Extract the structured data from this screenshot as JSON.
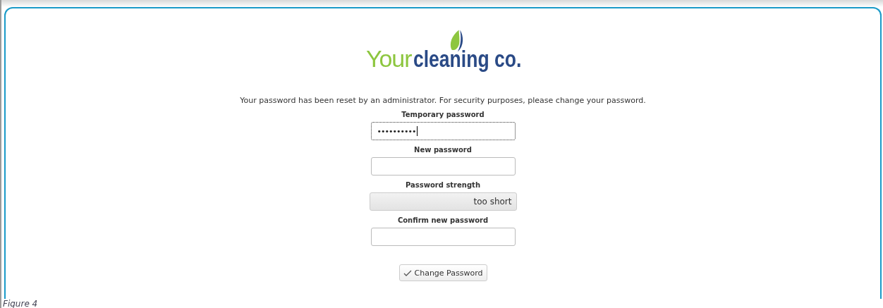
{
  "logo": {
    "word_1": "Your",
    "word_2": "cleaning co."
  },
  "message": "Your password has been reset by an administrator. For security purposes, please change your password.",
  "fields": [
    {
      "kind": "input",
      "label": "Temporary password",
      "value": "••••••••••",
      "focused": true
    },
    {
      "kind": "input",
      "label": "New password",
      "focused": false
    },
    {
      "kind": "meter",
      "label": "Password strength",
      "reading": "too short"
    },
    {
      "kind": "input",
      "label": "Confirm new password",
      "focused": false
    }
  ],
  "submit_button": {
    "label": "Change Password"
  },
  "caption": "Figure 4"
}
